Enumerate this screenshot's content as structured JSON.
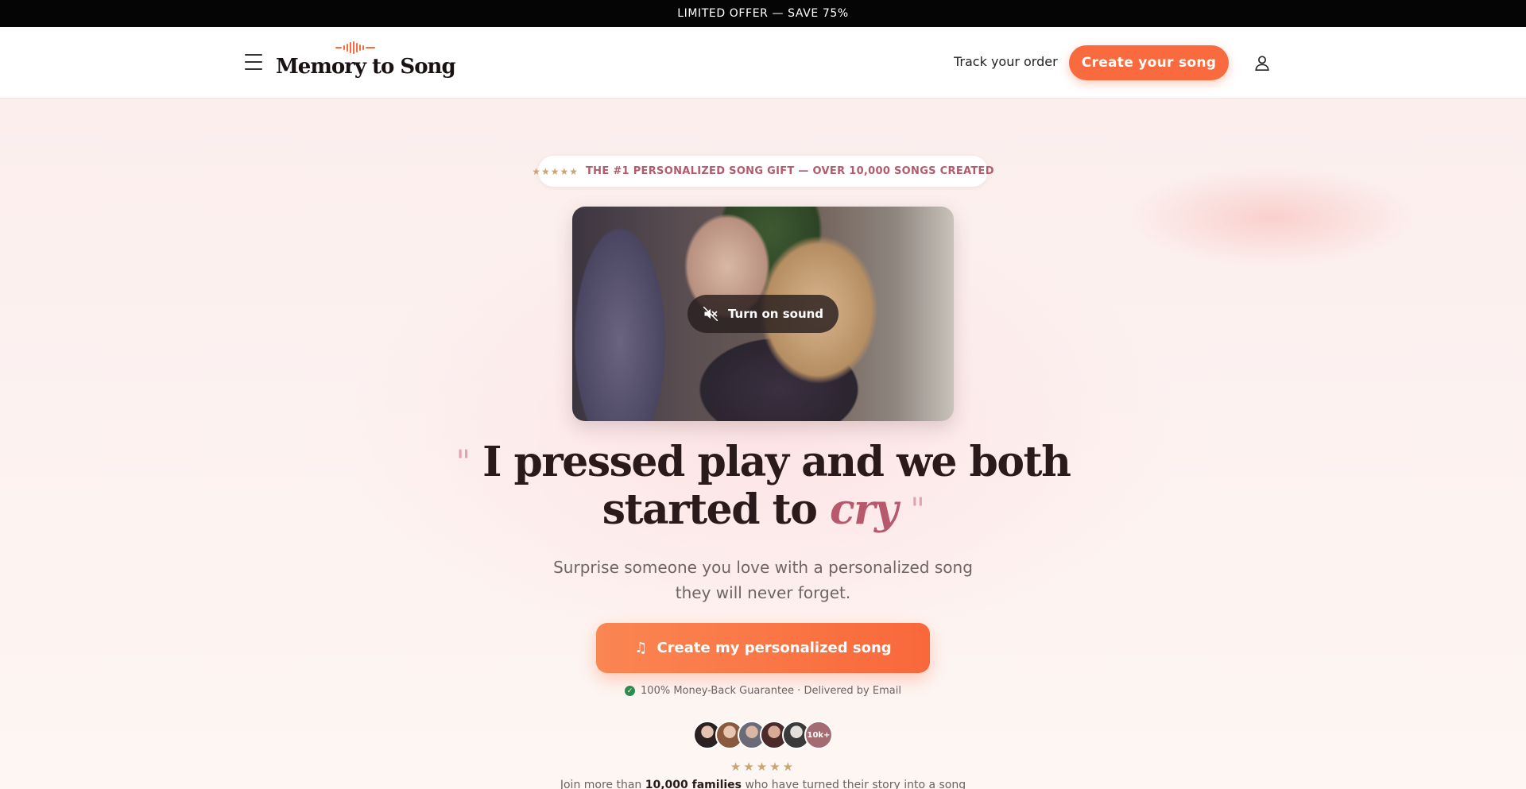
{
  "announcement": {
    "text": "LIMITED OFFER — SAVE 75%"
  },
  "header": {
    "logo_text": "Memory to Song",
    "track_order": "Track your order",
    "create_button": "Create your song"
  },
  "hero": {
    "badge_stars": "★★★★★",
    "badge_text": "THE #1 PERSONALIZED SONG GIFT — OVER 10,000 SONGS CREATED",
    "video": {
      "sound_button": "Turn on sound"
    },
    "headline": {
      "open_quote": "\"",
      "line1": "I pressed play and we both",
      "line2_start": "started to",
      "accent": "cry",
      "close_quote": "\""
    },
    "subtitle": "Surprise someone you love with a personalized song they will never forget.",
    "cta": {
      "icon": "♫",
      "label": "Create my personalized song"
    },
    "guarantee": "100% Money-Back Guarantee · Delivered by Email",
    "avatars_count": "10k+",
    "rating_stars": "★★★★★",
    "join": {
      "prefix": "Join more than",
      "highlight": "10,000 families",
      "suffix": "who have turned their story into a song"
    }
  },
  "colors": {
    "accent": "#f96b3f",
    "brand_rose": "#b8586c",
    "star_gold": "#c9a572",
    "guarantee_green": "#2e8b4e"
  }
}
